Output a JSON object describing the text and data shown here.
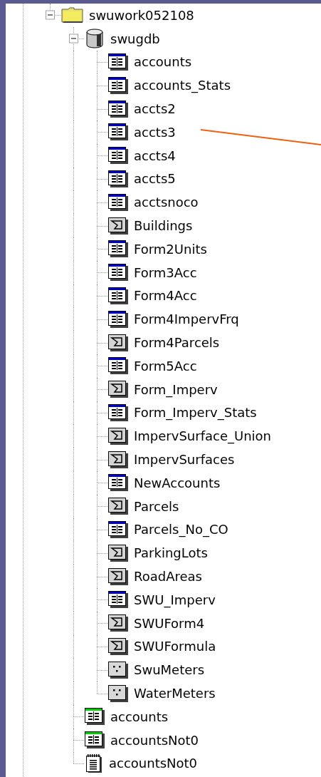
{
  "tree": [
    {
      "label": "swuwork052108",
      "kind": "folder",
      "expanded": true,
      "children": [
        {
          "label": "swugdb",
          "kind": "database",
          "expanded": true,
          "children": [
            {
              "label": "accounts",
              "kind": "table"
            },
            {
              "label": "accounts_Stats",
              "kind": "table"
            },
            {
              "label": "accts2",
              "kind": "table"
            },
            {
              "label": "accts3",
              "kind": "table"
            },
            {
              "label": "accts4",
              "kind": "table"
            },
            {
              "label": "accts5",
              "kind": "table"
            },
            {
              "label": "acctsnoco",
              "kind": "table"
            },
            {
              "label": "Buildings",
              "kind": "polygon"
            },
            {
              "label": "Form2Units",
              "kind": "table"
            },
            {
              "label": "Form3Acc",
              "kind": "table"
            },
            {
              "label": "Form4Acc",
              "kind": "table"
            },
            {
              "label": "Form4ImpervFrq",
              "kind": "table"
            },
            {
              "label": "Form4Parcels",
              "kind": "polygon"
            },
            {
              "label": "Form5Acc",
              "kind": "table"
            },
            {
              "label": "Form_Imperv",
              "kind": "polygon"
            },
            {
              "label": "Form_Imperv_Stats",
              "kind": "table"
            },
            {
              "label": "ImpervSurface_Union",
              "kind": "polygon"
            },
            {
              "label": "ImpervSurfaces",
              "kind": "polygon"
            },
            {
              "label": "NewAccounts",
              "kind": "table"
            },
            {
              "label": "Parcels",
              "kind": "polygon"
            },
            {
              "label": "Parcels_No_CO",
              "kind": "table"
            },
            {
              "label": "ParkingLots",
              "kind": "polygon"
            },
            {
              "label": "RoadAreas",
              "kind": "polygon"
            },
            {
              "label": "SWU_Imperv",
              "kind": "table"
            },
            {
              "label": "SWUForm4",
              "kind": "polygon"
            },
            {
              "label": "SWUFormula",
              "kind": "polygon"
            },
            {
              "label": "SwuMeters",
              "kind": "point"
            },
            {
              "label": "WaterMeters",
              "kind": "point"
            }
          ]
        },
        {
          "label": "accounts",
          "kind": "standalone_table"
        },
        {
          "label": "accountsNot0",
          "kind": "standalone_table"
        },
        {
          "label": "accountsNot0",
          "kind": "text_file"
        }
      ]
    }
  ]
}
